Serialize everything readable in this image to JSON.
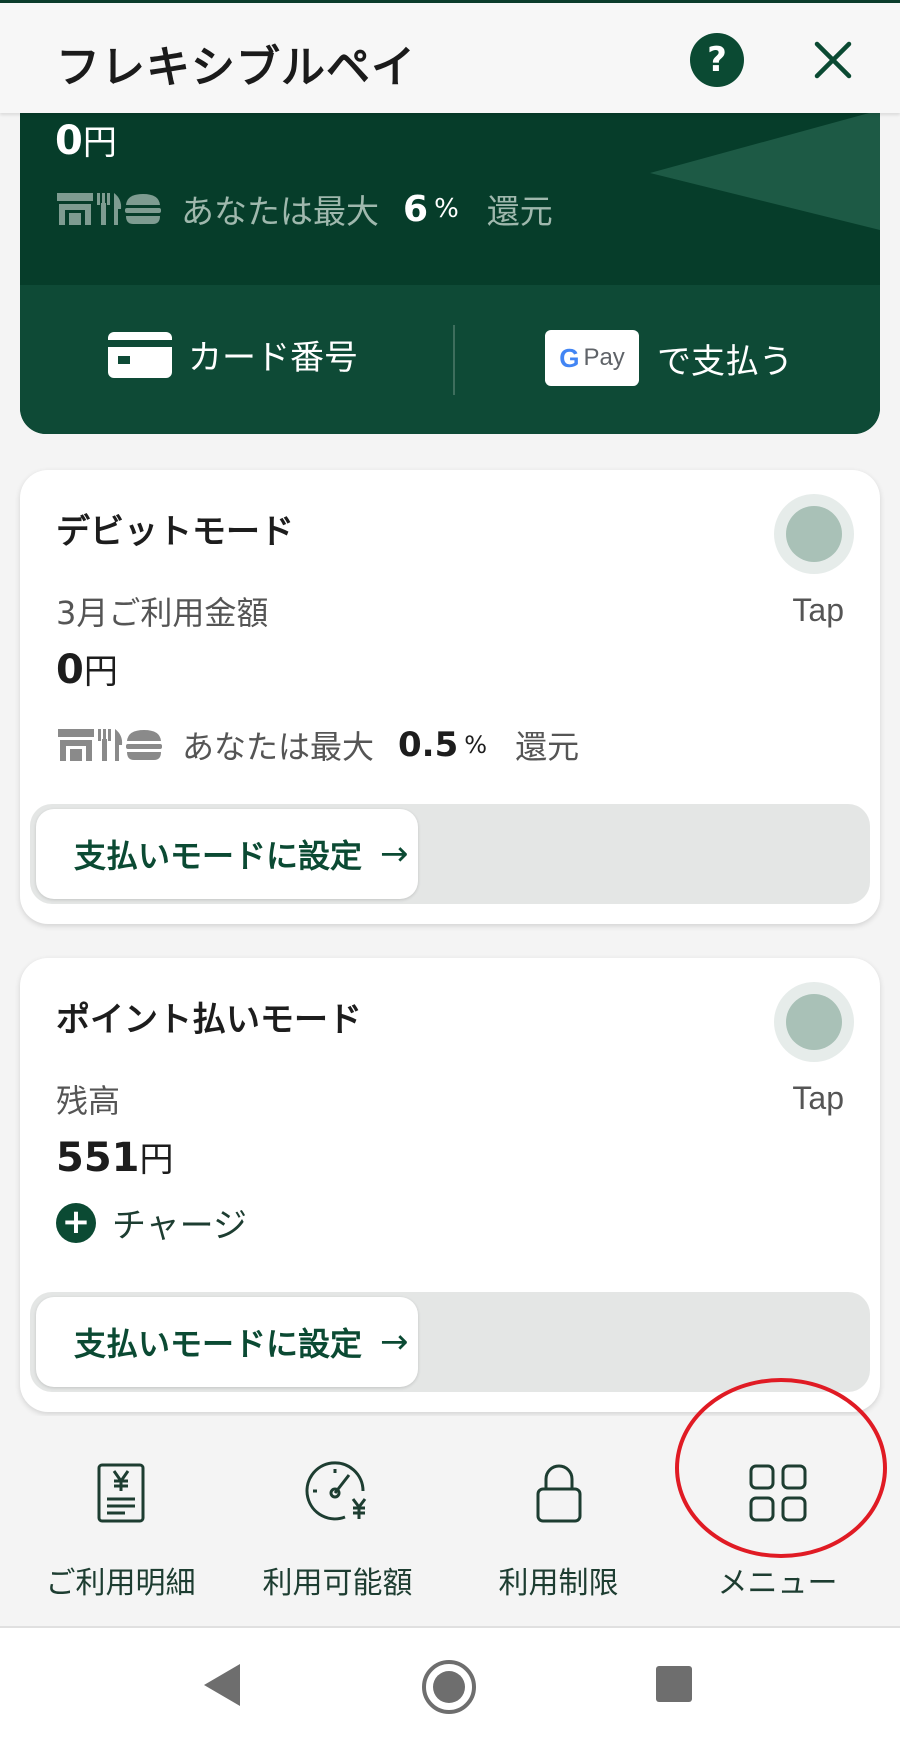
{
  "app": {
    "title": "フレキシブルペイ",
    "help_label": "?"
  },
  "credit_card": {
    "amount_value": "0",
    "amount_unit": "円",
    "cashback_prefix": "あなたは最大",
    "cashback_pct": "6",
    "cashback_pct_unit": "%",
    "cashback_suffix": "還元",
    "card_number_label": "カード番号",
    "gpay_badge_g": "G",
    "gpay_badge_pay": "Pay",
    "gpay_label": "で支払う"
  },
  "debit_mode": {
    "title": "デビットモード",
    "tap_label": "Tap",
    "usage_label": "3月ご利用金額",
    "amount_value": "0",
    "amount_unit": "円",
    "cashback_prefix": "あなたは最大",
    "cashback_pct": "0.5",
    "cashback_pct_unit": "%",
    "cashback_suffix": "還元",
    "set_mode_label": "支払いモードに設定",
    "arrow": "→"
  },
  "point_mode": {
    "title": "ポイント払いモード",
    "tap_label": "Tap",
    "balance_label": "残高",
    "amount_value": "551",
    "amount_unit": "円",
    "charge_plus": "+",
    "charge_label": "チャージ",
    "set_mode_label": "支払いモードに設定",
    "arrow": "→"
  },
  "bottom_nav": {
    "items": [
      {
        "label": "ご利用明細",
        "icon": "statement-yen-icon"
      },
      {
        "label": "利用可能額",
        "icon": "gauge-yen-icon"
      },
      {
        "label": "利用制限",
        "icon": "lock-icon"
      },
      {
        "label": "メニュー",
        "icon": "grid-menu-icon"
      }
    ]
  },
  "colors": {
    "brand_dark_green": "#063d2a",
    "accent_green": "#0b4a33",
    "annotation_red": "#e01b24"
  }
}
